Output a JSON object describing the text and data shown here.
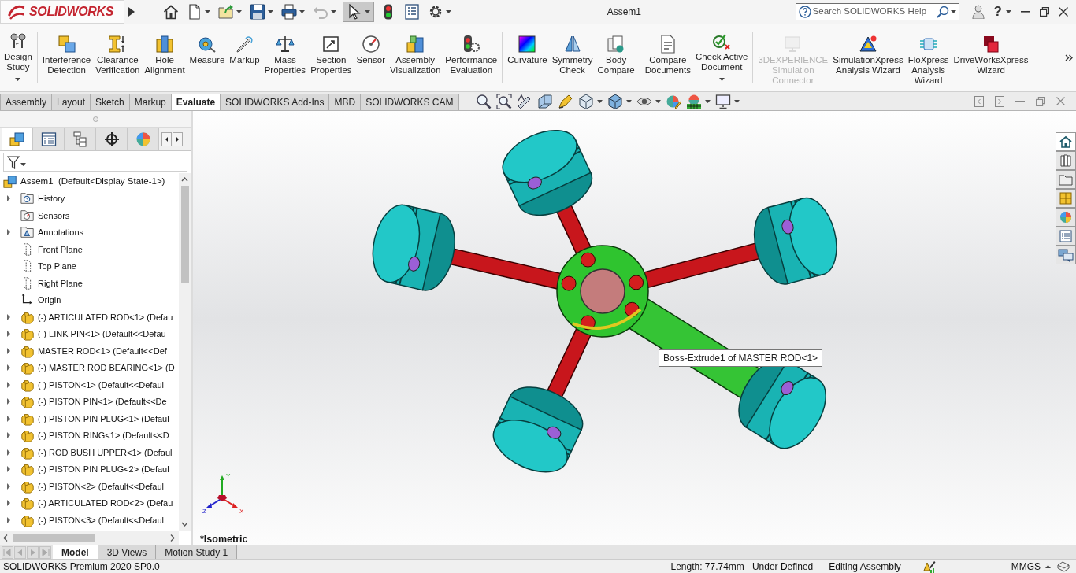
{
  "title_bar": {
    "logo": "**SOLID**WORKS",
    "quick_access": [
      {
        "dropdown": false,
        "disabled": false,
        "selected": false
      },
      {
        "dropdown": true,
        "disabled": false,
        "selected": false
      },
      {
        "dropdown": true,
        "disabled": false,
        "selected": false
      },
      {
        "dropdown": true,
        "disabled": false,
        "selected": false
      },
      {
        "dropdown": true,
        "disabled": false,
        "selected": false
      },
      {
        "dropdown": true,
        "disabled": true,
        "selected": false
      },
      {
        "dropdown": true,
        "disabled": false,
        "selected": true
      },
      {
        "dropdown": false,
        "disabled": false,
        "selected": false
      },
      {
        "dropdown": false,
        "disabled": false,
        "selected": false
      },
      {
        "dropdown": true,
        "disabled": false,
        "selected": false
      }
    ],
    "title": "Assem1",
    "help_search": {
      "placeholder": "Search SOLIDWORKS Help"
    },
    "help_button": "?"
  },
  "ribbon": {
    "groups": [
      [
        {
          "lines": [
            "Design",
            "Study"
          ],
          "dropdown": true,
          "disabled": false
        }
      ],
      [
        {
          "lines": [
            "Interference",
            "Detection"
          ],
          "dropdown": false,
          "disabled": false
        },
        {
          "lines": [
            "Clearance",
            "Verification"
          ],
          "dropdown": false,
          "disabled": false
        },
        {
          "lines": [
            "Hole",
            "Alignment"
          ],
          "dropdown": false,
          "disabled": false
        },
        {
          "lines": [
            "Measure"
          ],
          "dropdown": false,
          "disabled": false
        },
        {
          "lines": [
            "Markup"
          ],
          "dropdown": false,
          "disabled": false
        },
        {
          "lines": [
            "Mass",
            "Properties"
          ],
          "dropdown": false,
          "disabled": false
        },
        {
          "lines": [
            "Section",
            "Properties"
          ],
          "dropdown": false,
          "disabled": false
        },
        {
          "lines": [
            "Sensor"
          ],
          "dropdown": false,
          "disabled": false
        },
        {
          "lines": [
            "Assembly",
            "Visualization"
          ],
          "dropdown": false,
          "disabled": false
        },
        {
          "lines": [
            "Performance",
            "Evaluation"
          ],
          "dropdown": false,
          "disabled": false
        }
      ],
      [
        {
          "lines": [
            "Curvature"
          ],
          "dropdown": false,
          "disabled": false
        },
        {
          "lines": [
            "Symmetry",
            "Check"
          ],
          "dropdown": false,
          "disabled": false
        },
        {
          "lines": [
            "Body",
            "Compare"
          ],
          "dropdown": false,
          "disabled": false
        }
      ],
      [
        {
          "lines": [
            "Compare",
            "Documents"
          ],
          "dropdown": false,
          "disabled": false
        },
        {
          "lines": [
            "Check Active",
            "Document"
          ],
          "dropdown": true,
          "disabled": false
        }
      ],
      [
        {
          "lines": [
            "3DEXPERIENCE",
            "Simulation",
            "Connector"
          ],
          "dropdown": false,
          "disabled": true
        },
        {
          "lines": [
            "SimulationXpress",
            "Analysis Wizard"
          ],
          "dropdown": false,
          "disabled": false
        },
        {
          "lines": [
            "FloXpress",
            "Analysis",
            "Wizard"
          ],
          "dropdown": false,
          "disabled": false
        },
        {
          "lines": [
            "DriveWorksXpress",
            "Wizard"
          ],
          "dropdown": false,
          "disabled": false
        }
      ]
    ]
  },
  "command_tabs": [
    {
      "label": "Assembly",
      "selected": false
    },
    {
      "label": "Layout",
      "selected": false
    },
    {
      "label": "Sketch",
      "selected": false
    },
    {
      "label": "Markup",
      "selected": false
    },
    {
      "label": "Evaluate",
      "selected": true
    },
    {
      "label": "SOLIDWORKS Add-Ins",
      "selected": false
    },
    {
      "label": "MBD",
      "selected": false
    },
    {
      "label": "SOLIDWORKS CAM",
      "selected": false
    }
  ],
  "view_toolbar": [
    {
      "dropdown": false
    },
    {
      "dropdown": false
    },
    {
      "dropdown": false
    },
    {
      "dropdown": false
    },
    {
      "dropdown": false
    },
    {
      "dropdown": true
    },
    {
      "dropdown": true
    },
    {
      "dropdown": true
    },
    {
      "dropdown": false
    },
    {
      "dropdown": true
    },
    {
      "dropdown": true
    }
  ],
  "feature_manager": {
    "tabs": [
      {
        "selected": true
      },
      {
        "selected": false
      },
      {
        "selected": false
      },
      {
        "selected": false
      },
      {
        "selected": false
      }
    ],
    "tree": {
      "label": "Assem1  (Default<Display State-1>)",
      "kind": "assembly",
      "children": [
        {
          "label": "History",
          "kind": "history",
          "expandable": true
        },
        {
          "label": "Sensors",
          "kind": "sensors",
          "expandable": false
        },
        {
          "label": "Annotations",
          "kind": "annotations",
          "expandable": true
        },
        {
          "label": "Front Plane",
          "kind": "plane",
          "expandable": false
        },
        {
          "label": "Top Plane",
          "kind": "plane",
          "expandable": false
        },
        {
          "label": "Right Plane",
          "kind": "plane",
          "expandable": false
        },
        {
          "label": "Origin",
          "kind": "origin",
          "expandable": false
        },
        {
          "label": "(-) ARTICULATED ROD<1> (Defau",
          "kind": "part",
          "expandable": true
        },
        {
          "label": "(-) LINK PIN<1> (Default<<Defau",
          "kind": "part",
          "expandable": true
        },
        {
          "label": "MASTER ROD<1> (Default<<Def",
          "kind": "part",
          "expandable": true
        },
        {
          "label": "(-) MASTER ROD BEARING<1> (D",
          "kind": "part",
          "expandable": true
        },
        {
          "label": "(-) PISTON<1> (Default<<Defaul",
          "kind": "part",
          "expandable": true
        },
        {
          "label": "(-) PISTON PIN<1> (Default<<De",
          "kind": "part",
          "expandable": true
        },
        {
          "label": "(-) PISTON PIN PLUG<1> (Defaul",
          "kind": "part",
          "expandable": true
        },
        {
          "label": "(-) PISTON RING<1> (Default<<D",
          "kind": "part",
          "expandable": true
        },
        {
          "label": "(-) ROD BUSH UPPER<1> (Defaul",
          "kind": "part",
          "expandable": true
        },
        {
          "label": "(-) PISTON PIN PLUG<2> (Defaul",
          "kind": "part",
          "expandable": true
        },
        {
          "label": "(-) PISTON<2> (Default<<Defaul",
          "kind": "part",
          "expandable": true
        },
        {
          "label": "(-) ARTICULATED ROD<2> (Defau",
          "kind": "part",
          "expandable": true
        },
        {
          "label": "(-) PISTON<3> (Default<<Defaul",
          "kind": "part",
          "expandable": true
        }
      ]
    }
  },
  "viewport": {
    "tooltip": "Boss-Extrude1 of MASTER ROD<1>",
    "triad_labels": [
      "Y",
      "X",
      "Z"
    ],
    "view_name": "*Isometric"
  },
  "bottom_tabs": [
    {
      "label": "Model",
      "selected": true
    },
    {
      "label": "3D Views",
      "selected": false
    },
    {
      "label": "Motion Study 1",
      "selected": false
    }
  ],
  "status_bar": {
    "product": "SOLIDWORKS Premium 2020 SP0.0",
    "items": [
      "Length: 77.74mm",
      "Under Defined",
      "Editing Assembly"
    ],
    "units": "MMGS"
  }
}
